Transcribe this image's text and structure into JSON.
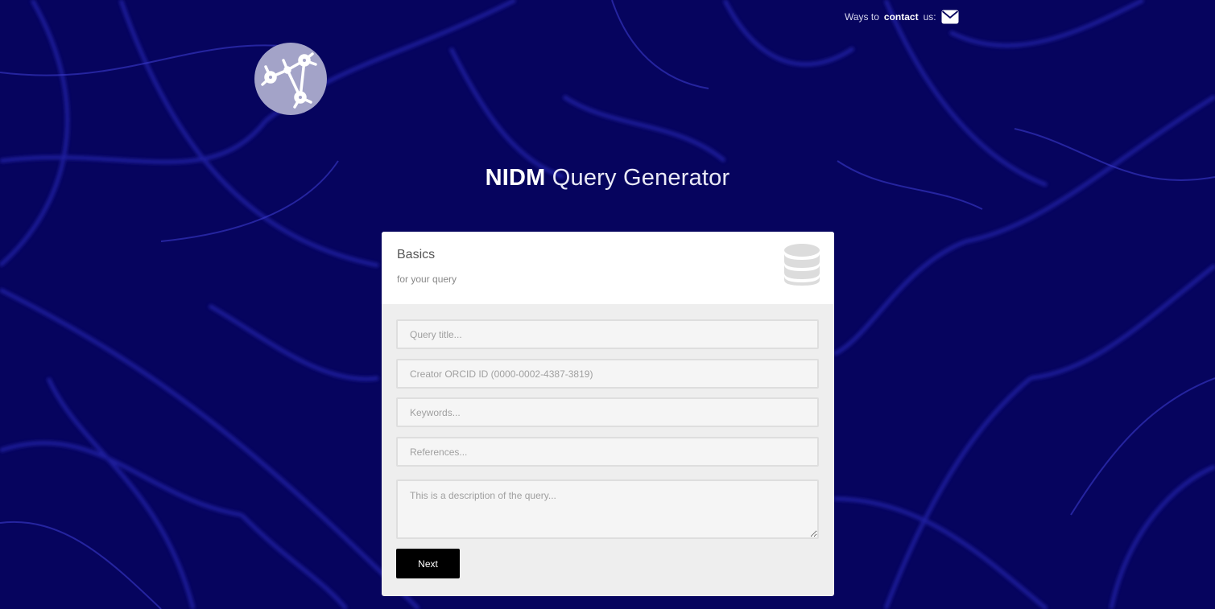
{
  "contact": {
    "prefix": "Ways to ",
    "strong": "contact",
    "suffix": " us:",
    "icon": "envelope-icon"
  },
  "logo": {
    "icon": "neuron-network-logo"
  },
  "title": {
    "strong": "NIDM",
    "light": " Query Generator"
  },
  "card": {
    "heading": "Basics",
    "subheading": "for your query",
    "icon": "database-icon",
    "fields": {
      "query_title": {
        "placeholder": "Query title..."
      },
      "creator_orcid": {
        "placeholder": "Creator ORCID ID (0000-0002-4387-3819)"
      },
      "keywords": {
        "placeholder": "Keywords..."
      },
      "references": {
        "placeholder": "References..."
      },
      "description": {
        "placeholder": "This is a description of the query..."
      }
    },
    "next_label": "Next"
  },
  "colors": {
    "background": "#06045e",
    "neuron_lines": "#2a2ab0",
    "card_body": "#eeeeee",
    "button": "#000000"
  }
}
